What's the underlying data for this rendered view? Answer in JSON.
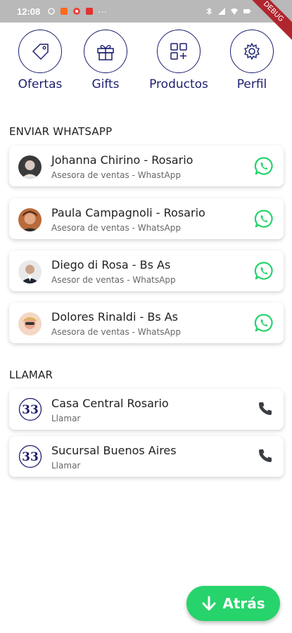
{
  "status_bar": {
    "time": "12:08",
    "dots": "···",
    "battery": "",
    "debug_label": "DEBUG"
  },
  "nav": [
    {
      "label": "Ofertas",
      "icon": "tag-icon"
    },
    {
      "label": "Gifts",
      "icon": "gift-icon"
    },
    {
      "label": "Productos",
      "icon": "grid-add-icon"
    },
    {
      "label": "Perfil",
      "icon": "gear-icon"
    }
  ],
  "whatsapp_section": {
    "title": "ENVIAR WHATSAPP",
    "contacts": [
      {
        "name": "Johanna Chirino - Rosario",
        "role": "Asesora de ventas - WhastApp"
      },
      {
        "name": "Paula Campagnoli - Rosario",
        "role": "Asesora de ventas - WhatsApp"
      },
      {
        "name": "Diego di Rosa - Bs As",
        "role": "Asesor de ventas - WhatsApp"
      },
      {
        "name": "Dolores Rinaldi - Bs As",
        "role": "Asesora de ventas - WhatsApp"
      }
    ]
  },
  "call_section": {
    "title": "LLAMAR",
    "locations": [
      {
        "name": "Casa Central Rosario",
        "action": "Llamar"
      },
      {
        "name": "Sucursal Buenos Aires",
        "action": "Llamar"
      }
    ]
  },
  "back_button": {
    "label": "Atrás"
  },
  "colors": {
    "brand": "#1c1f6e",
    "whatsapp": "#27d36b",
    "status_bar": "#b9b9b9"
  }
}
